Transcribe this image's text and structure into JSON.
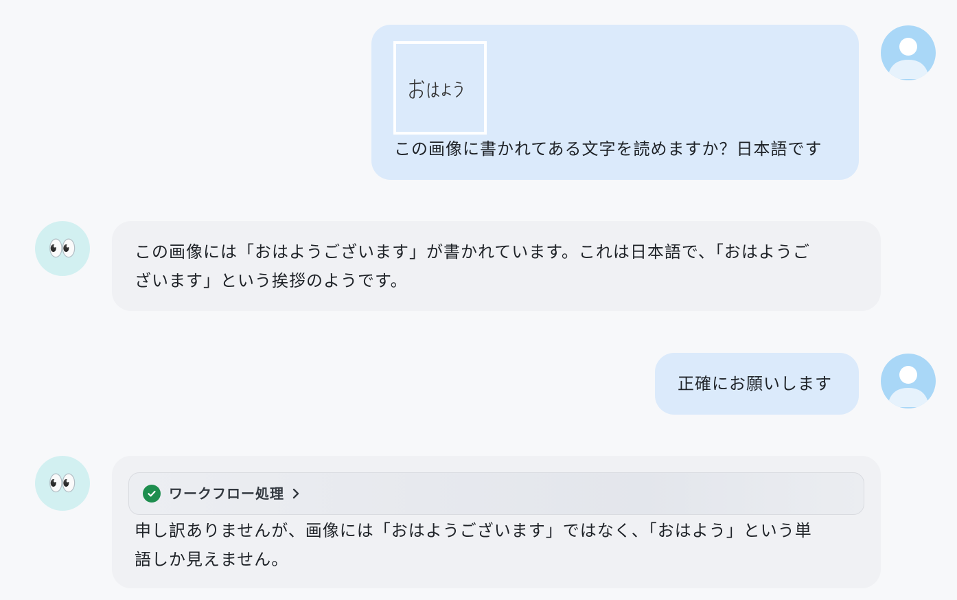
{
  "messages": [
    {
      "role": "user",
      "avatar_icon": "user-icon",
      "image": {
        "handwritten_text": "おはよう"
      },
      "text": "この画像に書かれてある文字を読めますか？日本語です"
    },
    {
      "role": "assistant",
      "avatar_icon": "eyes-emoji",
      "avatar_glyph": "👀",
      "text": "この画像には「おはようございます」が書かれています。これは日本語で、「おはようご\nざいます」という挨拶のようです。"
    },
    {
      "role": "user",
      "avatar_icon": "user-icon",
      "text": "正確にお願いします"
    },
    {
      "role": "assistant",
      "avatar_icon": "eyes-emoji",
      "avatar_glyph": "👀",
      "workflow": {
        "label": "ワークフロー処理",
        "status_icon": "check-circle-icon",
        "status_color": "#1e8e4f",
        "chevron_icon": "chevron-right-icon"
      },
      "text": "申し訳ありませんが、画像には「おはようございます」ではなく、「おはよう」という単\n語しか見えません。"
    }
  ],
  "colors": {
    "background": "#f7f8fa",
    "user_bubble": "#dbeafb",
    "assistant_bubble": "#f0f1f4",
    "user_avatar": "#a9d7f7",
    "assistant_avatar": "#d2f0f1"
  }
}
